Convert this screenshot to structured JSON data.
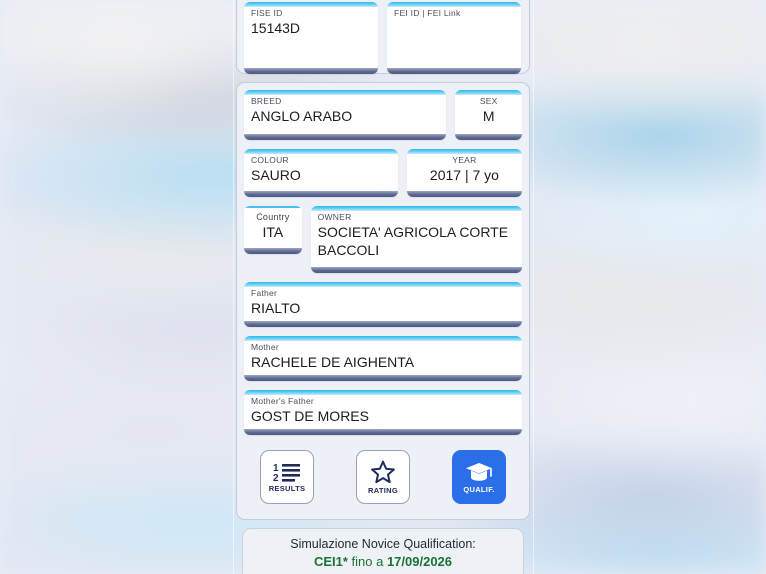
{
  "fields": {
    "fise_id": {
      "label": "FISE ID",
      "value": "15143D"
    },
    "fei": {
      "label": "FEI ID | FEI Link",
      "value": ""
    },
    "breed": {
      "label": "BREED",
      "value": "ANGLO ARABO"
    },
    "sex": {
      "label": "SEX",
      "value": "M"
    },
    "colour": {
      "label": "COLOUR",
      "value": "SAURO"
    },
    "year": {
      "label": "YEAR",
      "value": "2017 | 7 yo"
    },
    "country": {
      "label": "Country",
      "value": "ITA"
    },
    "owner": {
      "label": "OWNER",
      "value": "SOCIETA' AGRICOLA CORTE BACCOLI"
    },
    "father": {
      "label": "Father",
      "value": "RIALTO"
    },
    "mother": {
      "label": "Mother",
      "value": "RACHELE DE AIGHENTA"
    },
    "mothers_father": {
      "label": "Mother's Father",
      "value": "GOST DE MORES"
    }
  },
  "actions": [
    {
      "icon": "numbered-list-icon",
      "label": "RESULTS"
    },
    {
      "icon": "star-icon",
      "label": "RATING"
    },
    {
      "icon": "graduation-cap-icon",
      "label": "QUALIF."
    }
  ],
  "note": {
    "line1": "Simulazione Novice Qualification:",
    "level": "CEI1*",
    "middle": " fino a ",
    "date": "17/09/2026"
  },
  "colors": {
    "card_top_accent": "#2fb7ef",
    "card_base_bar": "#5f6a91",
    "primary_button": "#2b6fe8",
    "note_green": "#1a7234"
  }
}
